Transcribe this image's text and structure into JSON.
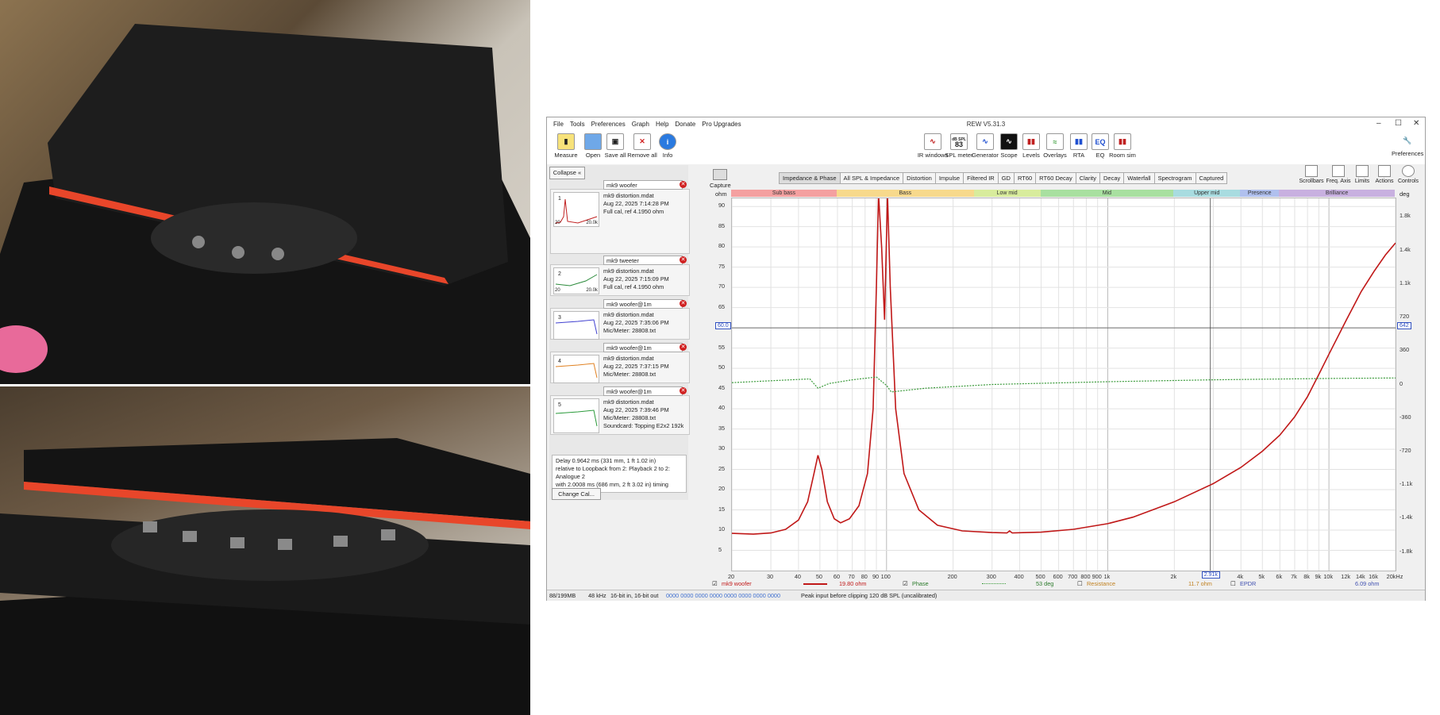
{
  "window": {
    "title": "REW V5.31.3",
    "menu": [
      "File",
      "Tools",
      "Preferences",
      "Graph",
      "Help",
      "Donate",
      "Pro Upgrades"
    ]
  },
  "toolbar_left": [
    "Measure",
    "Open",
    "Save all",
    "Remove all",
    "Info"
  ],
  "toolbar_center": [
    {
      "label": "IR windows",
      "icon": "ir-windows-icon"
    },
    {
      "label": "SPL meter",
      "icon": "spl-meter-icon",
      "badge_top": "dB SPL",
      "badge_value": "83"
    },
    {
      "label": "Generator",
      "icon": "generator-icon"
    },
    {
      "label": "Scope",
      "icon": "scope-icon"
    },
    {
      "label": "Levels",
      "icon": "levels-icon"
    },
    {
      "label": "Overlays",
      "icon": "overlays-icon"
    },
    {
      "label": "RTA",
      "icon": "rta-icon"
    },
    {
      "label": "EQ",
      "icon": "eq-icon"
    },
    {
      "label": "Room sim",
      "icon": "room-sim-icon"
    }
  ],
  "preferences_label": "Preferences",
  "collapse_label": "Collapse",
  "measurements": [
    {
      "num": "1",
      "name": "mk9 woofer",
      "file": "mk9 distortion.mdat",
      "date": "Aug 22, 2025 7:14:28 PM",
      "cal": "Full cal, ref 4.1950 ohm",
      "thumb_left": "20",
      "thumb_right": "20.0k",
      "color": "#c02020"
    },
    {
      "num": "2",
      "name": "mk9 tweeter",
      "file": "mk9 distortion.mdat",
      "date": "Aug 22, 2025 7:15:09 PM",
      "cal": "Full cal, ref 4.1950 ohm",
      "thumb_left": "20",
      "thumb_right": "20.0k",
      "color": "#2a8a3a"
    },
    {
      "num": "3",
      "name": "mk9 woofer@1m",
      "file": "mk9 distortion.mdat",
      "date": "Aug 22, 2025 7:35:06 PM",
      "cal": "Mic/Meter: 28808.txt",
      "thumb_left": "",
      "thumb_right": "",
      "color": "#4040d0"
    },
    {
      "num": "4",
      "name": "mk9 woofer@1m",
      "file": "mk9 distortion.mdat",
      "date": "Aug 22, 2025 7:37:15 PM",
      "cal": "Mic/Meter: 28808.txt",
      "thumb_left": "",
      "thumb_right": "",
      "color": "#e08020"
    },
    {
      "num": "5",
      "name": "mk9 woofer@1m",
      "file": "mk9 distortion.mdat",
      "date": "Aug 22, 2025 7:39:46 PM",
      "cal": "Mic/Meter: 28808.txt",
      "extra": "Soundcard: Topping E2x2 192k",
      "thumb_left": "",
      "thumb_right": "",
      "color": "#2a9a3a"
    }
  ],
  "notes": [
    "Delay 0.9642 ms (331 mm, 1 ft 1.02 in)",
    " relative to Loopback from 2: Playback 2 to 2:",
    "Analogue 2",
    "with 2.0008 ms (686 mm, 2 ft 3.02 in) timing offset"
  ],
  "change_cal_label": "Change Cal...",
  "capture_label": "Capture",
  "tabs": [
    "Impedance & Phase",
    "All SPL & Impedance",
    "Distortion",
    "Impulse",
    "Filtered IR",
    "GD",
    "RT60",
    "RT60 Decay",
    "Clarity",
    "Decay",
    "Waterfall",
    "Spectrogram",
    "Captured"
  ],
  "active_tab": "Impedance & Phase",
  "right_tools": [
    "Scrollbars",
    "Freq. Axis",
    "Limits",
    "Actions",
    "Controls"
  ],
  "bands": [
    {
      "label": "Sub bass",
      "color": "#f4a0a0",
      "from": 20,
      "to": 60
    },
    {
      "label": "Bass",
      "color": "#f7d98c",
      "from": 60,
      "to": 250
    },
    {
      "label": "Low mid",
      "color": "#d8ec9c",
      "from": 250,
      "to": 500
    },
    {
      "label": "Mid",
      "color": "#a8e0a0",
      "from": 500,
      "to": 2000
    },
    {
      "label": "Upper mid",
      "color": "#a8dce0",
      "from": 2000,
      "to": 4000
    },
    {
      "label": "Presence",
      "color": "#b0c0ee",
      "from": 4000,
      "to": 6000
    },
    {
      "label": "Brilliance",
      "color": "#c8b0e0",
      "from": 6000,
      "to": 20000
    }
  ],
  "left_unit": "ohm",
  "right_unit": "deg",
  "chart_data": {
    "type": "line",
    "x_scale": "log",
    "xlim": [
      20,
      20000
    ],
    "ylim": [
      0,
      92
    ],
    "y2lim": [
      -2000,
      2000
    ],
    "x_ticks": [
      "20",
      "30",
      "40",
      "50",
      "60",
      "70",
      "80",
      "90",
      "100",
      "200",
      "300",
      "400",
      "500",
      "600",
      "700",
      "800",
      "900",
      "1k",
      "2k",
      "3k",
      "4k",
      "5k",
      "6k",
      "7k",
      "8k",
      "9k",
      "10k",
      "12k",
      "14k",
      "16k",
      "20kHz"
    ],
    "x_tick_values": [
      20,
      30,
      40,
      50,
      60,
      70,
      80,
      90,
      100,
      200,
      300,
      400,
      500,
      600,
      700,
      800,
      900,
      1000,
      2000,
      3000,
      4000,
      5000,
      6000,
      7000,
      8000,
      9000,
      10000,
      12000,
      14000,
      16000,
      20000
    ],
    "y_ticks": [
      90,
      85,
      80,
      75,
      70,
      65,
      60,
      55,
      50,
      45,
      40,
      35,
      30,
      25,
      20,
      15,
      10,
      5
    ],
    "y2_ticks": [
      {
        "label": "1.8k",
        "value": 1800
      },
      {
        "label": "1.4k",
        "value": 1440
      },
      {
        "label": "1.1k",
        "value": 1080
      },
      {
        "label": "720",
        "value": 720
      },
      {
        "label": "360",
        "value": 360
      },
      {
        "label": "0",
        "value": 0
      },
      {
        "label": "-360",
        "value": -360
      },
      {
        "label": "-720",
        "value": -720
      },
      {
        "label": "-1.1k",
        "value": -1080
      },
      {
        "label": "-1.4k",
        "value": -1440
      },
      {
        "label": "-1.8k",
        "value": -1800
      }
    ],
    "cursor": {
      "y_label": "60.0",
      "y2_label": "642",
      "x_label": "2.91k",
      "y": 60,
      "x": 2910
    },
    "series": [
      {
        "name": "mk9 woofer",
        "color": "#c01818",
        "axis": "left",
        "points": [
          [
            20,
            9.2
          ],
          [
            25,
            9.0
          ],
          [
            30,
            9.3
          ],
          [
            35,
            10.2
          ],
          [
            40,
            12.5
          ],
          [
            44,
            17
          ],
          [
            47,
            24
          ],
          [
            49,
            28.5
          ],
          [
            51,
            25
          ],
          [
            54,
            17
          ],
          [
            58,
            12.8
          ],
          [
            62,
            11.8
          ],
          [
            68,
            12.8
          ],
          [
            75,
            16
          ],
          [
            82,
            24
          ],
          [
            87,
            40
          ],
          [
            90,
            70
          ],
          [
            92,
            93
          ],
          [
            95,
            80
          ],
          [
            98,
            62
          ],
          [
            101,
            93
          ],
          [
            104,
            70
          ],
          [
            110,
            40
          ],
          [
            120,
            24
          ],
          [
            140,
            15
          ],
          [
            170,
            11.2
          ],
          [
            220,
            9.8
          ],
          [
            300,
            9.4
          ],
          [
            350,
            9.3
          ],
          [
            360,
            9.8
          ],
          [
            370,
            9.3
          ],
          [
            500,
            9.5
          ],
          [
            700,
            10.2
          ],
          [
            1000,
            11.6
          ],
          [
            1300,
            13.2
          ],
          [
            2000,
            17
          ],
          [
            3000,
            21.5
          ],
          [
            4000,
            25.5
          ],
          [
            5000,
            29.5
          ],
          [
            6000,
            33.5
          ],
          [
            7000,
            38
          ],
          [
            8000,
            43
          ],
          [
            9000,
            48.5
          ],
          [
            10000,
            53.5
          ],
          [
            12000,
            62
          ],
          [
            14000,
            69
          ],
          [
            16000,
            74
          ],
          [
            18000,
            78
          ],
          [
            20000,
            81
          ]
        ]
      },
      {
        "name": "Phase",
        "color": "#3a9a3a",
        "axis": "right",
        "points": [
          [
            20,
            20
          ],
          [
            30,
            40
          ],
          [
            45,
            60
          ],
          [
            49,
            -40
          ],
          [
            55,
            10
          ],
          [
            70,
            50
          ],
          [
            90,
            80
          ],
          [
            100,
            -10
          ],
          [
            105,
            -80
          ],
          [
            150,
            -40
          ],
          [
            300,
            0
          ],
          [
            1000,
            30
          ],
          [
            3000,
            50
          ],
          [
            10000,
            65
          ],
          [
            20000,
            70
          ]
        ]
      }
    ]
  },
  "legend": {
    "main": {
      "name": "mk9 woofer",
      "value": "19.80 ohm"
    },
    "phase": {
      "name": "Phase",
      "value": "53 deg"
    },
    "resistance": {
      "name": "Resistance",
      "value": "11.7 ohm"
    },
    "epdr": {
      "name": "EPDR",
      "value": "6.09 ohm"
    }
  },
  "status": {
    "memory": "88/199MB",
    "rate": "48 kHz",
    "bits": "16-bit in, 16-bit out",
    "levels": "0000 0000  0000 0000  0000 0000  0000 0000",
    "message": "Peak input before clipping 120 dB SPL (uncalibrated)"
  }
}
